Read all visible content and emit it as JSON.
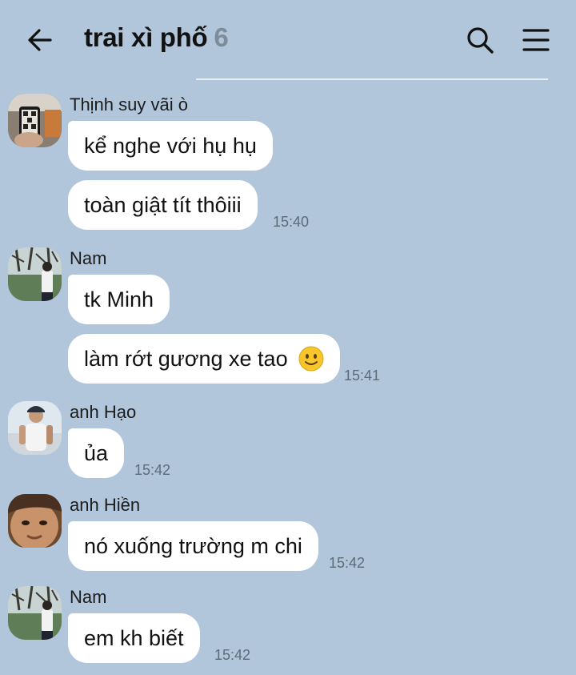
{
  "header": {
    "title": "trai xì phố",
    "member_count": "6"
  },
  "icons": {
    "back": "arrow-left-icon",
    "search": "search-icon",
    "menu": "hamburger-menu-icon"
  },
  "messages": [
    {
      "sender": "Thịnh suy vãi ò",
      "bubbles": [
        "kể nghe với hụ hụ",
        "toàn giật tít thôiii"
      ],
      "time": "15:40"
    },
    {
      "sender": "Nam",
      "bubbles": [
        "tk Minh",
        "làm rớt gương xe tao"
      ],
      "time": "15:41",
      "emoji": "slightly-smiling-face-icon"
    },
    {
      "sender": "anh Hạo",
      "bubbles": [
        "ủa"
      ],
      "time": "15:42"
    },
    {
      "sender": "anh Hiền",
      "bubbles": [
        "nó xuống trường m chi"
      ],
      "time": "15:42"
    },
    {
      "sender": "Nam",
      "bubbles": [
        "em kh biết"
      ],
      "time": "15:42"
    }
  ],
  "colors": {
    "background": "#b1c6da",
    "bubble": "#ffffff",
    "timestamp": "#5d6b79",
    "member_count": "#7e8c99"
  }
}
